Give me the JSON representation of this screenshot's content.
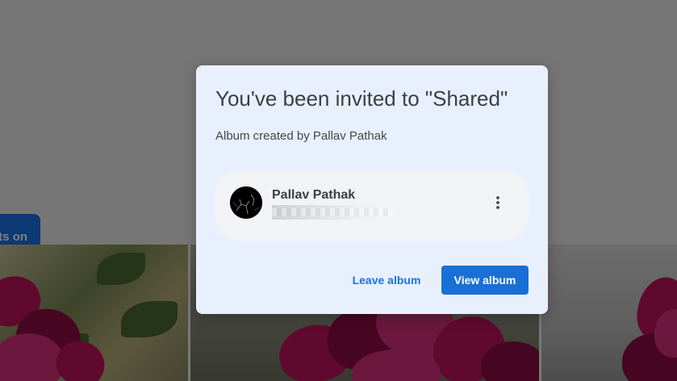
{
  "background": {
    "pill_label": "ts on"
  },
  "dialog": {
    "title": "You've been invited to \"Shared\"",
    "subtitle": "Album created by Pallav Pathak",
    "owner": {
      "name": "Pallav Pathak",
      "more_icon": "more-vert-icon"
    },
    "actions": {
      "leave_label": "Leave album",
      "view_label": "View album"
    }
  },
  "colors": {
    "accent": "#1a73e8",
    "dialog_bg": "#e9f0fd",
    "primary_button": "#1a6fd6"
  }
}
